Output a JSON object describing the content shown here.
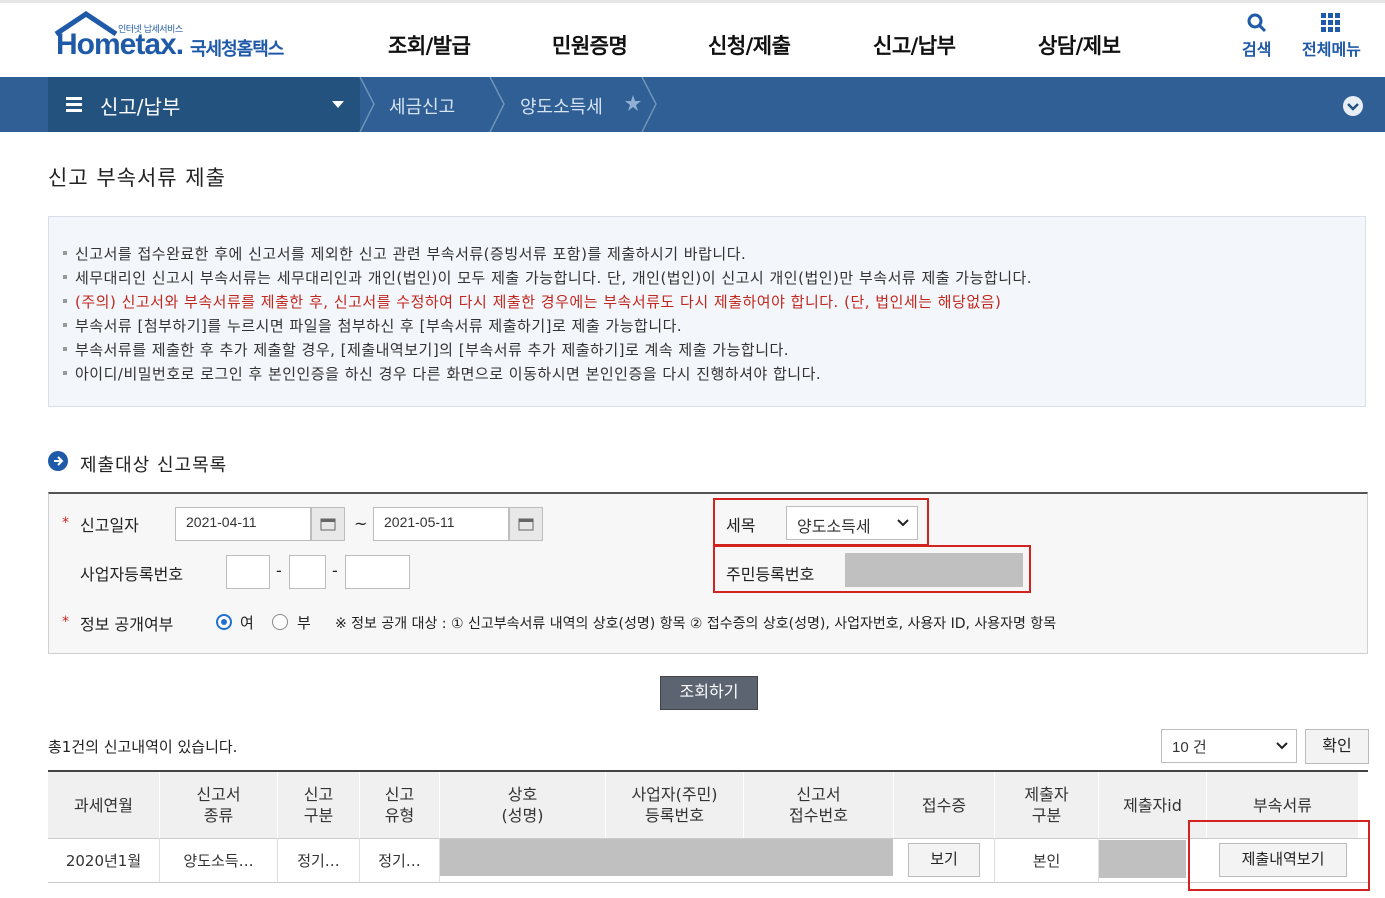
{
  "logo": {
    "small": "인터넷 납세서비스",
    "main": "Hometax.",
    "kr": "국세청홈택스"
  },
  "gnb": [
    "조회/발급",
    "민원증명",
    "신청/제출",
    "신고/납부",
    "상담/제보"
  ],
  "tools": {
    "search": "검색",
    "allmenu": "전체메뉴"
  },
  "nav": {
    "menu": "신고/납부",
    "crumb1": "세금신고",
    "crumb2": "양도소득세"
  },
  "page_title": "신고 부속서류 제출",
  "notices": [
    "신고서를 접수완료한 후에 신고서를 제외한 신고 관련 부속서류(증빙서류 포함)를 제출하시기 바랍니다.",
    "세무대리인 신고시 부속서류는 세무대리인과 개인(법인)이 모두 제출 가능합니다. 단, 개인(법인)이 신고시 개인(법인)만 부속서류 제출 가능합니다.",
    "(주의) 신고서와 부속서류를 제출한 후, 신고서를 수정하여 다시 제출한 경우에는 부속서류도 다시 제출하여야 합니다. (단, 법인세는 해당없음)",
    "부속서류 [첨부하기]를 누르시면 파일을 첨부하신 후 [부속서류 제출하기]로 제출 가능합니다.",
    "부속서류를 제출한 후 추가 제출할 경우, [제출내역보기]의 [부속서류 추가 제출하기]로 계속 제출 가능합니다.",
    "아이디/비밀번호로 로그인 후 본인인증을 하신 경우 다른 화면으로 이동하시면 본인인증을 다시 진행하셔야 합니다."
  ],
  "section_title": "제출대상 신고목록",
  "form": {
    "date_label": "신고일자",
    "date_from": "2021-04-11",
    "tilde": "~",
    "date_to": "2021-05-11",
    "tax_label": "세목",
    "tax_value": "양도소득세",
    "biz_label": "사업자등록번호",
    "dash": "-",
    "rrn_label": "주민등록번호",
    "disclose_label": "정보 공개여부",
    "yes": "여",
    "no": "부",
    "disclose_note": "※ 정보 공개 대상 : ① 신고부속서류 내역의 상호(성명) 항목 ② 접수증의 상호(성명), 사업자번호, 사용자 ID, 사용자명 항목",
    "req_mark": "*"
  },
  "search_button": "조회하기",
  "result_count": "총1건의 신고내역이 있습니다.",
  "page_size": "10 건",
  "confirm_button": "확인",
  "table": {
    "headers": [
      "과세연월",
      "신고서\n종류",
      "신고\n구분",
      "신고\n유형",
      "상호\n(성명)",
      "사업자(주민)\n등록번호",
      "신고서\n접수번호",
      "접수증",
      "제출자\n구분",
      "제출자id",
      "부속서류"
    ],
    "row": {
      "period": "2020년1월",
      "kind": "양도소득…",
      "type": "정기…",
      "form": "정기…",
      "receipt_btn": "보기",
      "submitter": "본인",
      "docs_btn": "제출내역보기"
    }
  }
}
